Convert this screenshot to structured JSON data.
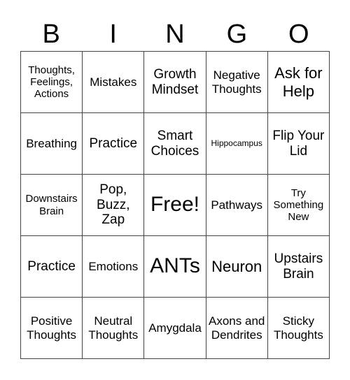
{
  "header": [
    "B",
    "I",
    "N",
    "G",
    "O"
  ],
  "cells": [
    {
      "text": "Thoughts, Feelings, Actions",
      "size": "s"
    },
    {
      "text": "Mistakes",
      "size": "m"
    },
    {
      "text": "Growth Mindset",
      "size": "l"
    },
    {
      "text": "Negative Thoughts",
      "size": "m"
    },
    {
      "text": "Ask for Help",
      "size": "xl"
    },
    {
      "text": "Breathing",
      "size": "m"
    },
    {
      "text": "Practice",
      "size": "l"
    },
    {
      "text": "Smart Choices",
      "size": "l"
    },
    {
      "text": "Hippocampus",
      "size": "xs"
    },
    {
      "text": "Flip Your Lid",
      "size": "l"
    },
    {
      "text": "Downstairs Brain",
      "size": "s"
    },
    {
      "text": "Pop, Buzz, Zap",
      "size": "l"
    },
    {
      "text": "Free!",
      "size": "xxl"
    },
    {
      "text": "Pathways",
      "size": "m"
    },
    {
      "text": "Try Something New",
      "size": "s"
    },
    {
      "text": "Practice",
      "size": "l"
    },
    {
      "text": "Emotions",
      "size": "m"
    },
    {
      "text": "ANTs",
      "size": "xxl"
    },
    {
      "text": "Neuron",
      "size": "xl"
    },
    {
      "text": "Upstairs Brain",
      "size": "l"
    },
    {
      "text": "Positive Thoughts",
      "size": "m"
    },
    {
      "text": "Neutral Thoughts",
      "size": "m"
    },
    {
      "text": "Amygdala",
      "size": "m"
    },
    {
      "text": "Axons and Dendrites",
      "size": "m"
    },
    {
      "text": "Sticky Thoughts",
      "size": "m"
    }
  ]
}
